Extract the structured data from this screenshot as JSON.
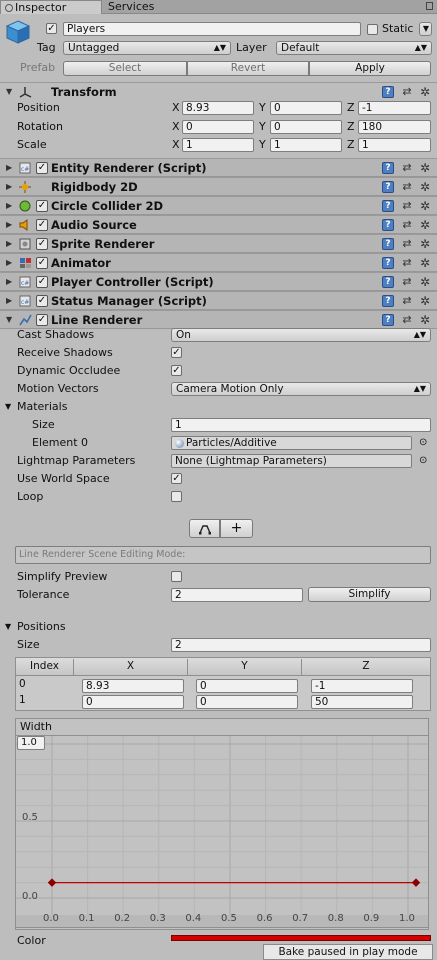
{
  "tabs": {
    "inspector": "Inspector",
    "services": "Services"
  },
  "object": {
    "name": "Players",
    "static_label": "Static",
    "tag_label": "Tag",
    "tag_value": "Untagged",
    "layer_label": "Layer",
    "layer_value": "Default",
    "prefab_label": "Prefab",
    "prefab_select": "Select",
    "prefab_revert": "Revert",
    "prefab_apply": "Apply"
  },
  "transform": {
    "title": "Transform",
    "position_label": "Position",
    "rotation_label": "Rotation",
    "scale_label": "Scale",
    "x": "X",
    "y": "Y",
    "z": "Z",
    "position": [
      "8.93",
      "0",
      "-1"
    ],
    "rotation": [
      "0",
      "0",
      "180"
    ],
    "scale": [
      "1",
      "1",
      "1"
    ]
  },
  "components": [
    {
      "title": "Entity Renderer (Script)",
      "icon": "script-icon",
      "checkbox": true
    },
    {
      "title": "Rigidbody 2D",
      "icon": "rigidbody-icon",
      "checkbox": false
    },
    {
      "title": "Circle Collider 2D",
      "icon": "circle-collider-icon",
      "checkbox": true
    },
    {
      "title": "Audio Source",
      "icon": "audio-source-icon",
      "checkbox": true
    },
    {
      "title": "Sprite Renderer",
      "icon": "sprite-renderer-icon",
      "checkbox": true
    },
    {
      "title": "Animator",
      "icon": "animator-icon",
      "checkbox": true
    },
    {
      "title": "Player Controller (Script)",
      "icon": "script-icon",
      "checkbox": true
    },
    {
      "title": "Status Manager (Script)",
      "icon": "script-icon",
      "checkbox": true
    },
    {
      "title": "Line Renderer",
      "icon": "line-renderer-icon",
      "checkbox": true
    }
  ],
  "line_renderer": {
    "cast_shadows_label": "Cast Shadows",
    "cast_shadows_value": "On",
    "receive_shadows_label": "Receive Shadows",
    "dynamic_occludee_label": "Dynamic Occludee",
    "motion_vectors_label": "Motion Vectors",
    "motion_vectors_value": "Camera Motion Only",
    "materials_label": "Materials",
    "size_label": "Size",
    "materials_size": "1",
    "element0_label": "Element 0",
    "element0_value": "Particles/Additive",
    "lightmap_label": "Lightmap Parameters",
    "lightmap_value": "None (Lightmap Parameters)",
    "world_space_label": "Use World Space",
    "loop_label": "Loop",
    "scene_editing_mode": "Line Renderer Scene Editing Mode:",
    "simplify_preview_label": "Simplify Preview",
    "tolerance_label": "Tolerance",
    "tolerance_value": "2",
    "simplify_button": "Simplify",
    "positions_label": "Positions",
    "positions_size_label": "Size",
    "positions_size": "2",
    "table_headers": [
      "Index",
      "X",
      "Y",
      "Z"
    ],
    "rows": [
      [
        "0",
        "8.93",
        "0",
        "-1"
      ],
      [
        "1",
        "0",
        "0",
        "50"
      ]
    ],
    "width_label": "Width",
    "width_top_value": "1.0",
    "width_y_ticks": [
      "0.5",
      "0.0"
    ],
    "width_x_ticks": [
      "0.0",
      "0.1",
      "0.2",
      "0.3",
      "0.4",
      "0.5",
      "0.6",
      "0.7",
      "0.8",
      "0.9",
      "1.0"
    ],
    "width_curve_value": 0.1,
    "color_label": "Color"
  },
  "status": {
    "text": "Bake paused in play mode"
  },
  "colors": {
    "curve": "#c00000",
    "color_gradient": "#d40000",
    "help_icon": "#4d7fc2"
  }
}
